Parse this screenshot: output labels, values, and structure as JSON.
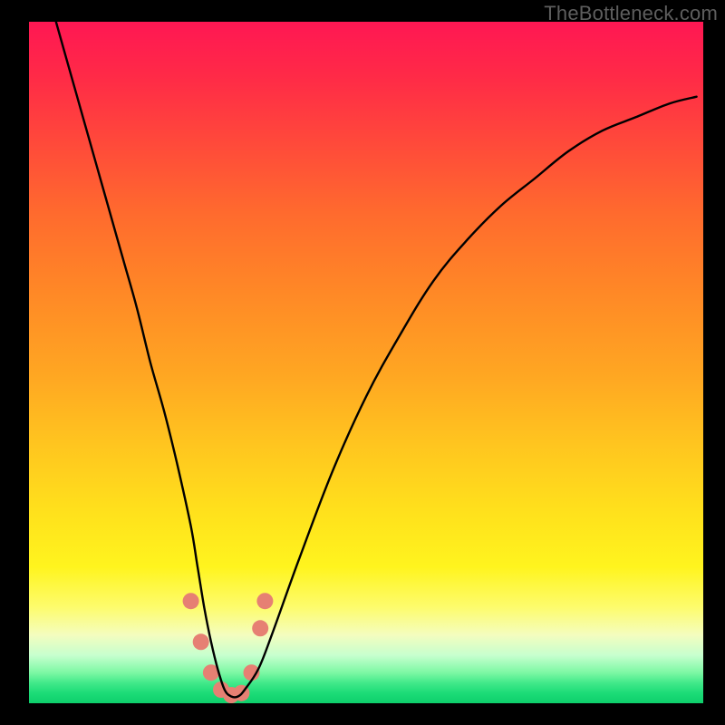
{
  "watermark": "TheBottleneck.com",
  "chart_data": {
    "type": "line",
    "title": "",
    "xlabel": "",
    "ylabel": "",
    "xlim": [
      0,
      100
    ],
    "ylim": [
      0,
      100
    ],
    "series": [
      {
        "name": "bottleneck-curve",
        "x": [
          4,
          6,
          8,
          10,
          12,
          14,
          16,
          18,
          20,
          22,
          24,
          25,
          26,
          27,
          28,
          29,
          30,
          31,
          32,
          34,
          36,
          40,
          45,
          50,
          55,
          60,
          65,
          70,
          75,
          80,
          85,
          90,
          95,
          99
        ],
        "values": [
          100,
          93,
          86,
          79,
          72,
          65,
          58,
          50,
          43,
          35,
          26,
          20,
          14,
          9,
          5,
          2,
          1,
          1,
          2,
          5,
          10,
          21,
          34,
          45,
          54,
          62,
          68,
          73,
          77,
          81,
          84,
          86,
          88,
          89
        ]
      }
    ],
    "markers": {
      "name": "highlight-dots",
      "points": [
        {
          "x": 24.0,
          "y": 15.0
        },
        {
          "x": 25.5,
          "y": 9.0
        },
        {
          "x": 27.0,
          "y": 4.5
        },
        {
          "x": 28.5,
          "y": 2.0
        },
        {
          "x": 30.0,
          "y": 1.2
        },
        {
          "x": 31.5,
          "y": 1.5
        },
        {
          "x": 33.0,
          "y": 4.5
        },
        {
          "x": 34.3,
          "y": 11.0
        },
        {
          "x": 35.0,
          "y": 15.0
        }
      ],
      "color": "#e68073",
      "radius_px": 9
    },
    "gradient_stops": [
      {
        "pos": 0.0,
        "color": "#ff1753"
      },
      {
        "pos": 0.28,
        "color": "#ff6a2e"
      },
      {
        "pos": 0.62,
        "color": "#ffc51f"
      },
      {
        "pos": 0.8,
        "color": "#fff41e"
      },
      {
        "pos": 0.93,
        "color": "#c6ffce"
      },
      {
        "pos": 1.0,
        "color": "#0ecf6c"
      }
    ]
  }
}
